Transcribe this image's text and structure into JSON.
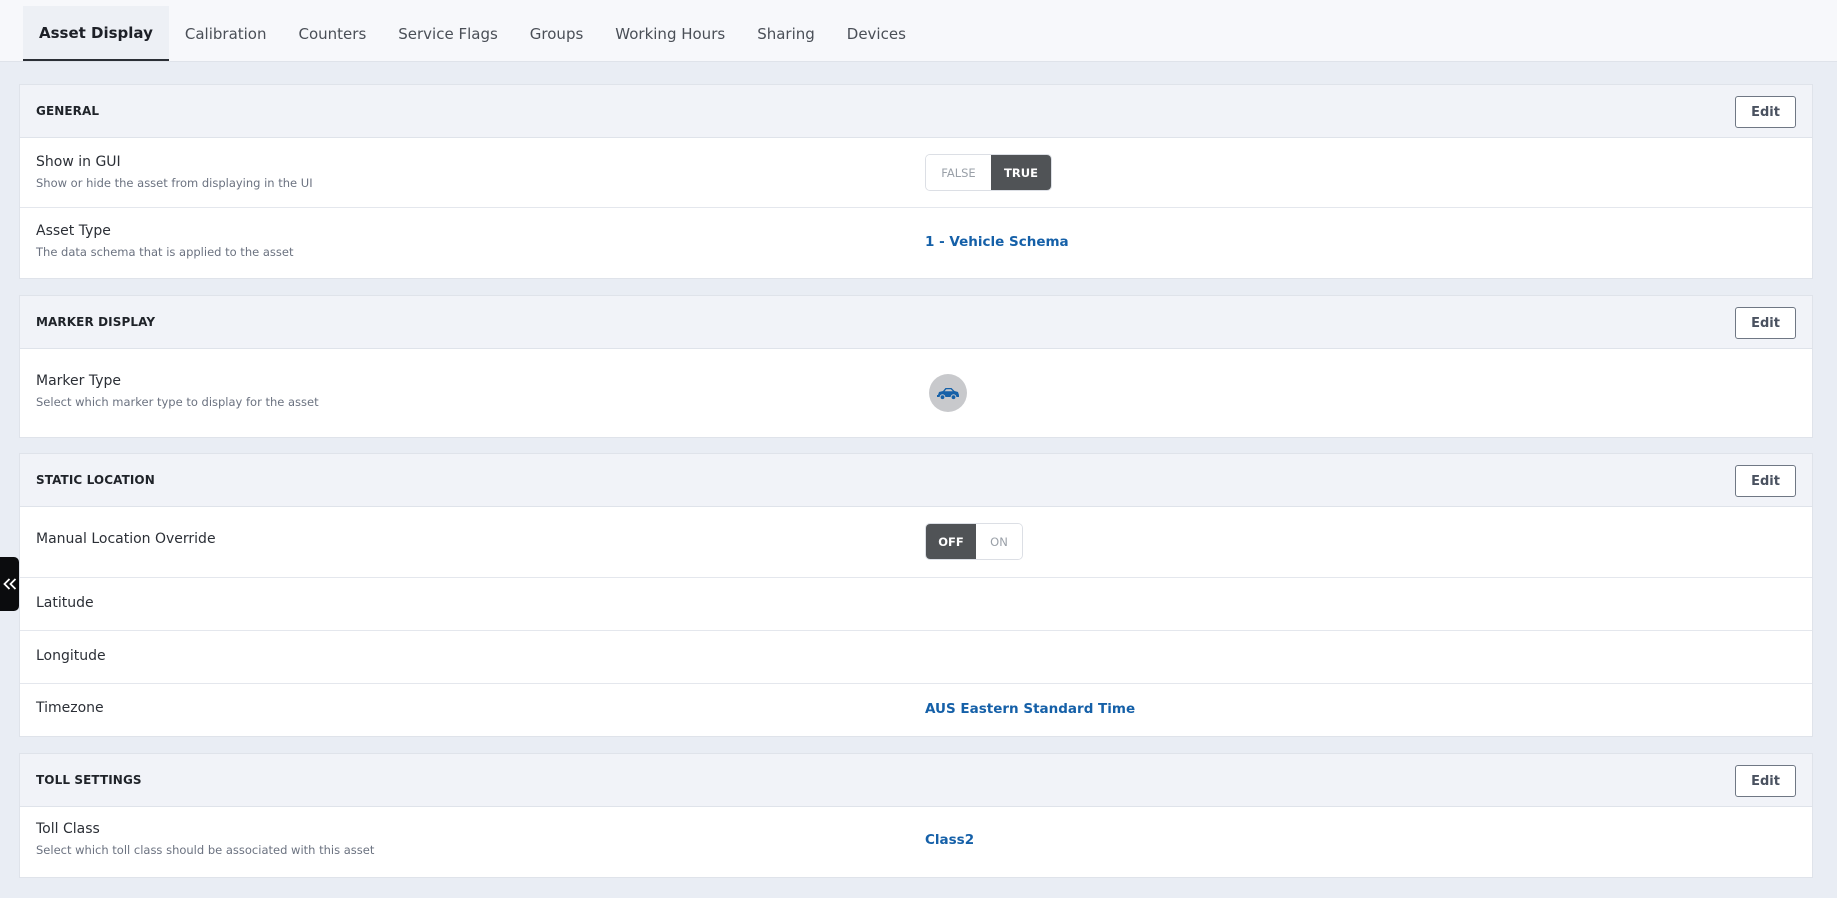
{
  "tabs": [
    {
      "label": "Asset Display",
      "active": true
    },
    {
      "label": "Calibration"
    },
    {
      "label": "Counters"
    },
    {
      "label": "Service Flags"
    },
    {
      "label": "Groups"
    },
    {
      "label": "Working Hours"
    },
    {
      "label": "Sharing"
    },
    {
      "label": "Devices"
    }
  ],
  "edit_label": "Edit",
  "general": {
    "title": "GENERAL",
    "show_in_gui": {
      "label": "Show in GUI",
      "description": "Show or hide the asset from displaying in the UI",
      "options": [
        "FALSE",
        "TRUE"
      ],
      "selected": "TRUE"
    },
    "asset_type": {
      "label": "Asset Type",
      "description": "The data schema that is applied to the asset",
      "value": "1 - Vehicle Schema"
    }
  },
  "marker_display": {
    "title": "MARKER DISPLAY",
    "marker_type": {
      "label": "Marker Type",
      "description": "Select which marker type to display for the asset",
      "icon": "car-icon",
      "icon_color": "#1560a8"
    }
  },
  "static_location": {
    "title": "STATIC LOCATION",
    "manual_override": {
      "label": "Manual Location Override",
      "options": [
        "OFF",
        "ON"
      ],
      "selected": "OFF"
    },
    "latitude": {
      "label": "Latitude",
      "value": ""
    },
    "longitude": {
      "label": "Longitude",
      "value": ""
    },
    "timezone": {
      "label": "Timezone",
      "value": "AUS Eastern Standard Time"
    }
  },
  "toll_settings": {
    "title": "TOLL SETTINGS",
    "toll_class": {
      "label": "Toll Class",
      "description": "Select which toll class should be associated with this asset",
      "value": "Class2"
    }
  },
  "colors": {
    "link": "#1560a8",
    "toggle_active": "#505356",
    "background": "#e9edf4"
  }
}
